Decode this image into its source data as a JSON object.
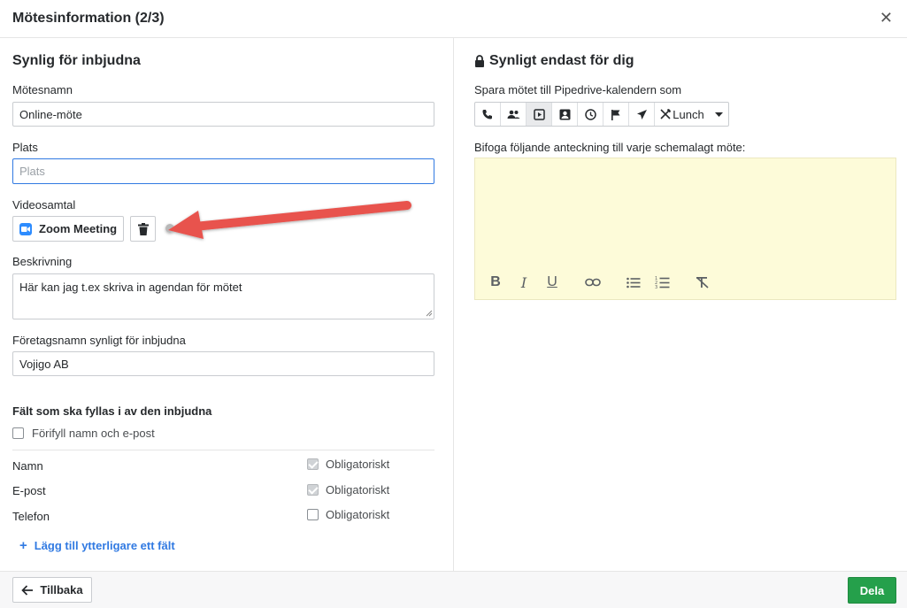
{
  "header": {
    "title": "Mötesinformation (2/3)",
    "close_glyph": "✕"
  },
  "left": {
    "section_title": "Synlig för inbjudna",
    "meeting_name": {
      "label": "Mötesnamn",
      "value": "Online-möte"
    },
    "location": {
      "label": "Plats",
      "placeholder": "Plats"
    },
    "video": {
      "label": "Videosamtal",
      "button_label": "Zoom Meeting",
      "icon": "zoom-icon"
    },
    "description": {
      "label": "Beskrivning",
      "value": "Här kan jag t.ex skriva in agendan för mötet"
    },
    "company": {
      "label": "Företagsnamn synligt för inbjudna",
      "value": "Vojigo AB"
    },
    "fields_section": {
      "title": "Fält som ska fyllas i av den inbjudna",
      "prefill_label": "Förifyll namn och e-post",
      "prefill_checked": false,
      "rows": [
        {
          "name": "Namn",
          "required_label": "Obligatoriskt",
          "checked": true,
          "disabled": true
        },
        {
          "name": "E-post",
          "required_label": "Obligatoriskt",
          "checked": true,
          "disabled": true
        },
        {
          "name": "Telefon",
          "required_label": "Obligatoriskt",
          "checked": false,
          "disabled": false
        }
      ],
      "add_field_label": "Lägg till ytterligare ett fält"
    }
  },
  "right": {
    "section_title": "Synligt endast för dig",
    "calendar_label": "Spara mötet till Pipedrive-kalendern som",
    "activity_types": [
      "call-icon",
      "meeting-icon",
      "task-icon",
      "contact-icon",
      "deadline-icon",
      "flag-icon",
      "email-icon"
    ],
    "active_type": "task-icon",
    "lunch_label": "Lunch",
    "note_label": "Bifoga följande anteckning till varje schemalagt möte:",
    "note_tools": [
      "bold-icon",
      "italic-icon",
      "underline-icon",
      "link-icon",
      "bullet-list-icon",
      "numbered-list-icon",
      "clear-format-icon"
    ]
  },
  "footer": {
    "back_label": "Tillbaka",
    "share_label": "Dela"
  },
  "colors": {
    "accent": "#317ae2",
    "primary_button": "#25a04b",
    "note_background": "#fdfbd9",
    "annotation_arrow": "#e8534d"
  }
}
